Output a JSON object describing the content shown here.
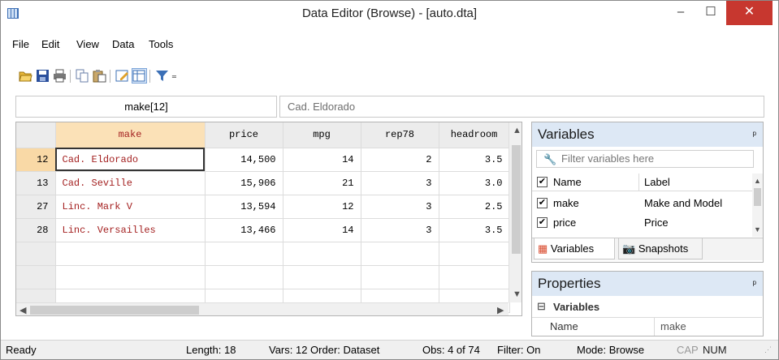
{
  "window": {
    "title": "Data Editor (Browse) - [auto.dta]",
    "min": "–",
    "max": "☐",
    "close": "✕"
  },
  "menu": [
    "File",
    "Edit",
    "View",
    "Data",
    "Tools"
  ],
  "toolbar": {
    "filter_dropdown": "₌"
  },
  "address": {
    "varname": "make[12]",
    "value": "Cad. Eldorado"
  },
  "grid": {
    "columns": [
      "make",
      "price",
      "mpg",
      "rep78",
      "headroom"
    ],
    "rows": [
      {
        "n": "12",
        "make": "Cad. Eldorado",
        "price": "14,500",
        "mpg": "14",
        "rep78": "2",
        "headroom": "3.5"
      },
      {
        "n": "13",
        "make": "Cad. Seville",
        "price": "15,906",
        "mpg": "21",
        "rep78": "3",
        "headroom": "3.0"
      },
      {
        "n": "27",
        "make": "Linc. Mark V",
        "price": "13,594",
        "mpg": "12",
        "rep78": "3",
        "headroom": "2.5"
      },
      {
        "n": "28",
        "make": "Linc. Versailles",
        "price": "13,466",
        "mpg": "14",
        "rep78": "3",
        "headroom": "3.5"
      }
    ]
  },
  "variables_panel": {
    "title": "Variables",
    "pin": "ᵖ",
    "filter_placeholder": "Filter variables here",
    "header_name": "Name",
    "header_label": "Label",
    "rows": [
      {
        "name": "make",
        "label": "Make and Model"
      },
      {
        "name": "price",
        "label": "Price"
      }
    ],
    "tab_variables": "Variables",
    "tab_snapshots": "Snapshots"
  },
  "properties_panel": {
    "title": "Properties",
    "pin": "ᵖ",
    "group": "Variables",
    "prop_name": "Name",
    "prop_value": "make"
  },
  "status": {
    "ready": "Ready",
    "length": "Length: 18",
    "vars": "Vars: 12  Order: Dataset",
    "obs": "Obs: 4 of 74",
    "filter": "Filter: On",
    "mode": "Mode: Browse",
    "cap": "CAP",
    "num": "NUM"
  },
  "colors": {
    "accent": "#3b6fb6",
    "make_text": "#a42121",
    "close": "#c7372f",
    "selected_row": "#f9d9a6"
  }
}
